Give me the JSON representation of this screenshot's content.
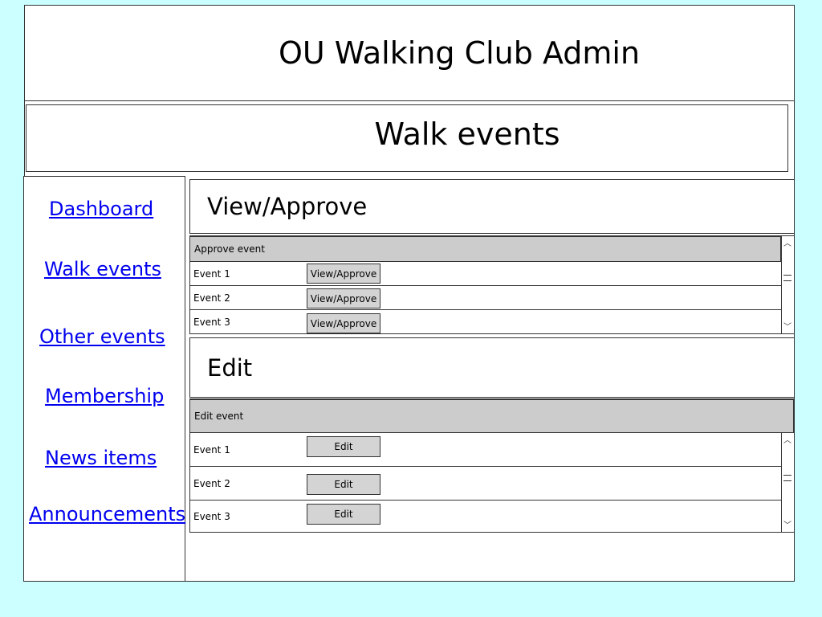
{
  "app": {
    "title": "OU Walking Club Admin"
  },
  "page": {
    "title": "Walk events"
  },
  "nav": {
    "items": [
      {
        "label": "Dashboard"
      },
      {
        "label": "Walk events"
      },
      {
        "label": "Other events"
      },
      {
        "label": "Membership"
      },
      {
        "label": "News items"
      },
      {
        "label": "Announcements"
      }
    ]
  },
  "approve_section": {
    "title": "View/Approve",
    "grid_header": "Approve event",
    "rows": [
      {
        "name": "Event 1",
        "button": "View/Approve"
      },
      {
        "name": "Event 2",
        "button": "View/Approve"
      },
      {
        "name": "Event 3",
        "button": "View/Approve"
      }
    ]
  },
  "edit_section": {
    "title": "Edit",
    "grid_header": "Edit event",
    "rows": [
      {
        "name": "Event 1",
        "button": "Edit"
      },
      {
        "name": "Event 2",
        "button": "Edit"
      },
      {
        "name": "Event 3",
        "button": "Edit"
      }
    ]
  },
  "colors": {
    "background": "#ccffff",
    "link": "#0000ee",
    "header_fill": "#cccccc",
    "button_fill": "#d4d4d4"
  }
}
